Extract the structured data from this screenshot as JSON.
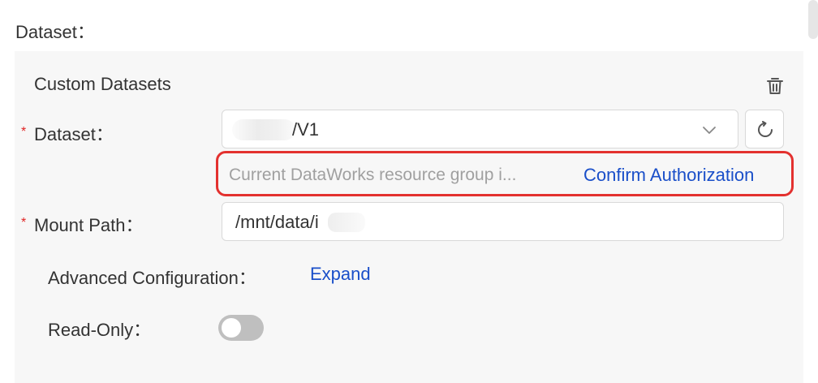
{
  "section": {
    "label": "Dataset："
  },
  "panel": {
    "title": "Custom Datasets",
    "required_marker": "*",
    "dataset": {
      "label": "Dataset：",
      "value": "/V1"
    },
    "authorization": {
      "hint": "Current DataWorks resource group i...",
      "confirm_label": "Confirm Authorization"
    },
    "mount_path": {
      "label": "Mount Path：",
      "value": "/mnt/data/i"
    },
    "advanced": {
      "label": "Advanced Configuration：",
      "expand_label": "Expand"
    },
    "read_only": {
      "label": "Read-Only：",
      "enabled": false
    }
  },
  "colors": {
    "link": "#1a4fc9",
    "highlight": "#e3312f",
    "required": "#e02424",
    "toggle_off": "#bfbfbf"
  },
  "icons": [
    "trash-icon",
    "chevron-down-icon",
    "refresh-icon"
  ]
}
